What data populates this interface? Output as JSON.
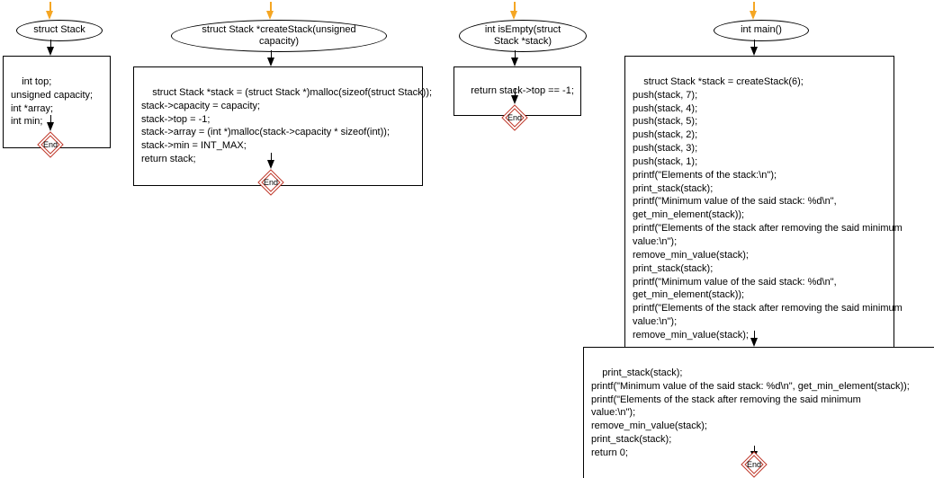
{
  "colors": {
    "arrow": "#f5a623",
    "end_border": "#c0392b",
    "end_text": "#000000"
  },
  "end_label": "End",
  "flow1": {
    "header": "struct Stack",
    "body": "int top;\nunsigned capacity;\nint *array;\nint min;"
  },
  "flow2": {
    "header": "struct Stack *createStack(unsigned\ncapacity)",
    "body": "struct Stack *stack = (struct Stack *)malloc(sizeof(struct Stack));\nstack->capacity = capacity;\nstack->top = -1;\nstack->array = (int *)malloc(stack->capacity * sizeof(int));\nstack->min = INT_MAX;\nreturn stack;"
  },
  "flow3": {
    "header": "int isEmpty(struct\nStack *stack)",
    "body": "return stack->top == -1;"
  },
  "flow4": {
    "header": "int main()",
    "body1": "struct Stack *stack = createStack(6);\npush(stack, 7);\npush(stack, 4);\npush(stack, 5);\npush(stack, 2);\npush(stack, 3);\npush(stack, 1);\nprintf(\"Elements of the stack:\\n\");\nprint_stack(stack);\nprintf(\"Minimum value of the said stack: %d\\n\",\nget_min_element(stack));\nprintf(\"Elements of the stack after removing the said minimum\nvalue:\\n\");\nremove_min_value(stack);\nprint_stack(stack);\nprintf(\"Minimum value of the said stack: %d\\n\",\nget_min_element(stack));\nprintf(\"Elements of the stack after removing the said minimum\nvalue:\\n\");\nremove_min_value(stack);",
    "body2": "print_stack(stack);\nprintf(\"Minimum value of the said stack: %d\\n\", get_min_element(stack));\nprintf(\"Elements of the stack after removing the said minimum\nvalue:\\n\");\nremove_min_value(stack);\nprint_stack(stack);\nreturn 0;"
  }
}
